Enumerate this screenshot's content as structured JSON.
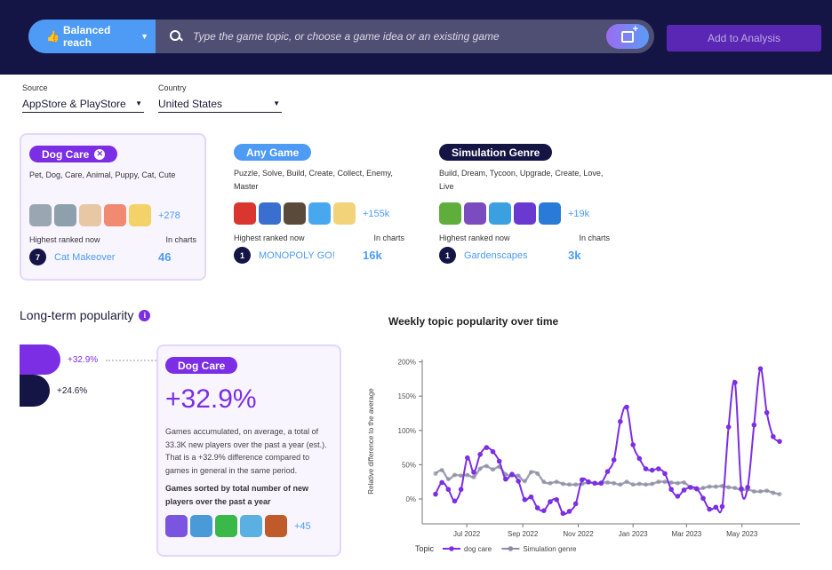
{
  "header": {
    "mode_label": "Balanced reach",
    "mode_icon": "thumbs-up-icon",
    "search_placeholder": "Type the game topic, or choose a game idea or an existing game",
    "add_button": "Add to Analysis"
  },
  "filters": {
    "source_label": "Source",
    "source_value": "AppStore & PlayStore",
    "country_label": "Country",
    "country_value": "United States"
  },
  "topics": [
    {
      "name": "Dog Care",
      "color": "#7b2ee4",
      "removable": true,
      "keywords": "Pet, Dog, Care, Animal, Puppy, Cat, Cute",
      "more": "+278",
      "icon_colors": [
        "#9aa7b3",
        "#8fa0ad",
        "#e8c7a4",
        "#f08a70",
        "#f4d26a"
      ],
      "highest_label": "Highest ranked now",
      "rank": "7",
      "top_game": "Cat Makeover",
      "charts_label": "In charts",
      "charts_count": "46"
    },
    {
      "name": "Any Game",
      "color": "#4d9bf5",
      "removable": false,
      "keywords": "Puzzle, Solve, Build, Create, Collect, Enemy, Master",
      "more": "+155k",
      "icon_colors": [
        "#d8362f",
        "#3a6fd0",
        "#5a4a3a",
        "#47a8f0",
        "#f2d37a"
      ],
      "highest_label": "Highest ranked now",
      "rank": "1",
      "top_game": "MONOPOLY GO!",
      "charts_label": "In charts",
      "charts_count": "16k"
    },
    {
      "name": "Simulation Genre",
      "color": "#151545",
      "removable": false,
      "keywords": "Build, Dream, Tycoon, Upgrade, Create, Love, Live",
      "more": "+19k",
      "icon_colors": [
        "#5fae3c",
        "#7a4cc0",
        "#3aa0e0",
        "#6a3ad0",
        "#2a7ad8"
      ],
      "highest_label": "Highest ranked now",
      "rank": "1",
      "top_game": "Gardenscapes",
      "charts_label": "In charts",
      "charts_count": "3k"
    }
  ],
  "popularity": {
    "title": "Long-term popularity",
    "bars": [
      {
        "label": "+32.9%",
        "value": 32.9,
        "color": "#7b2ee4"
      },
      {
        "label": "+24.6%",
        "value": 24.6,
        "color": "#151545"
      }
    ],
    "detail": {
      "chip": "Dog Care",
      "big": "+32.9%",
      "description": "Games accumulated, on average, a total of 33.3K new players over the past a year (est.). That is a +32.9% difference compared to games in general in the same period.",
      "sorted_label": "Games sorted by total number of new players over the past a year",
      "icon_colors": [
        "#7a55e0",
        "#4a9ad8",
        "#3ab84a",
        "#5ab0e0",
        "#c05a2a"
      ],
      "more": "+45"
    }
  },
  "chart_data": {
    "type": "line",
    "title": "Weekly topic popularity over time",
    "xlabel": "",
    "ylabel": "Relative difference to the average",
    "ylim": [
      -25,
      205
    ],
    "yticks": [
      "0%",
      "50%",
      "100%",
      "150%",
      "200%"
    ],
    "ytick_values": [
      0,
      50,
      100,
      150,
      200
    ],
    "xticks": [
      "Jul 2022",
      "Sep 2022",
      "Nov 2022",
      "Jan 2023",
      "Mar 2023",
      "May 2023"
    ],
    "xtick_weeks": [
      4.9,
      13.7,
      22.4,
      31,
      39.4,
      48.1
    ],
    "legend_title": "Topic",
    "legend_position": "bottom-left",
    "series": [
      {
        "name": "dog care",
        "color": "#7b2ee4",
        "values": [
          7,
          24,
          14,
          -3,
          14,
          60,
          39,
          65,
          75,
          69,
          55,
          29,
          36,
          26,
          -1,
          3,
          -13,
          -17,
          -4,
          -1,
          -21,
          -18,
          -7,
          28,
          25,
          23,
          23,
          40,
          57,
          113,
          134,
          79,
          59,
          44,
          42,
          44,
          37,
          14,
          4,
          13,
          17,
          15,
          1,
          -15,
          -12,
          -11,
          105,
          170,
          15,
          17,
          108,
          190,
          126,
          91,
          84
        ]
      },
      {
        "name": "Simulation genre",
        "color": "#8a8da3",
        "values": [
          37,
          42,
          29,
          35,
          34,
          35,
          32,
          44,
          48,
          43,
          47,
          36,
          34,
          34,
          26,
          39,
          37,
          25,
          23,
          25,
          22,
          21,
          21,
          22,
          24,
          23,
          24,
          24,
          23,
          21,
          25,
          21,
          22,
          21,
          22,
          25,
          25,
          24,
          23,
          24,
          17,
          14,
          16,
          18,
          18,
          19,
          17,
          16,
          13,
          14,
          11,
          11,
          12,
          9,
          7
        ]
      }
    ]
  }
}
